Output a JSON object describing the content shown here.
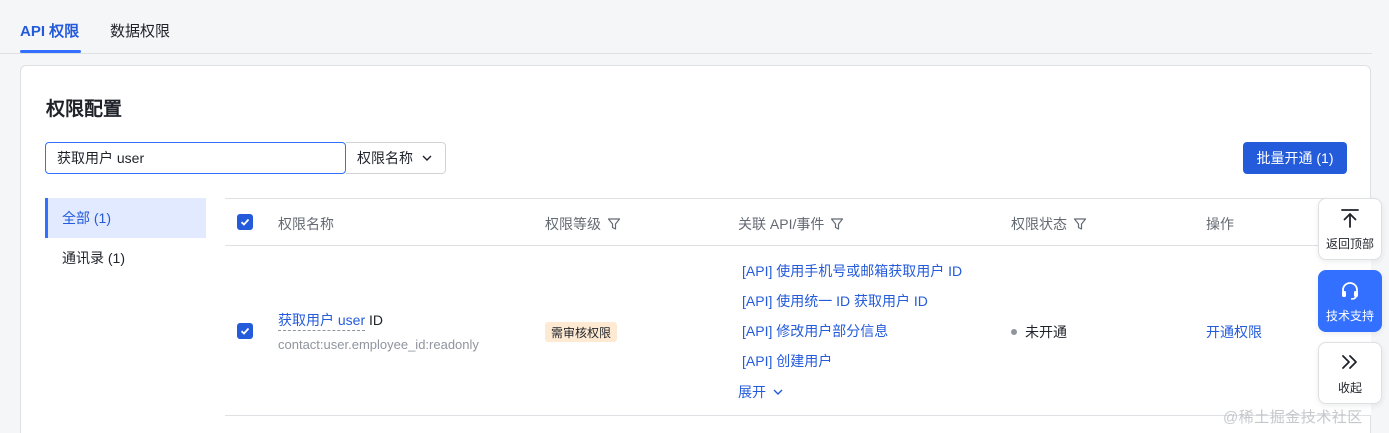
{
  "tabs": [
    {
      "label": "API 权限",
      "active": true
    },
    {
      "label": "数据权限",
      "active": false
    }
  ],
  "card": {
    "title": "权限配置"
  },
  "search": {
    "value": "获取用户 user",
    "filter_label": "权限名称"
  },
  "batch_button": "批量开通 (1)",
  "sidebar": {
    "items": [
      {
        "label": "全部 (1)",
        "active": true
      },
      {
        "label": "通讯录 (1)",
        "active": false
      }
    ]
  },
  "table": {
    "headers": {
      "name": "权限名称",
      "level": "权限等级",
      "api": "关联 API/事件",
      "status": "权限状态",
      "action": "操作"
    },
    "rows": [
      {
        "checked": true,
        "name_highlight": "获取用户 user",
        "name_rest": " ID",
        "code": "contact:user.employee_id:readonly",
        "level": "需审核权限",
        "apis": [
          "[API] 使用手机号或邮箱获取用户 ID",
          "[API] 使用统一 ID 获取用户 ID",
          "[API] 修改用户部分信息",
          "[API] 创建用户"
        ],
        "expand": "展开",
        "status": "未开通",
        "action": "开通权限"
      }
    ]
  },
  "float_toolbar": {
    "back_top": "返回顶部",
    "support": "技术支持",
    "collapse": "收起"
  },
  "watermark": "@稀土掘金技术社区",
  "colors": {
    "primary": "#245bdb",
    "accent": "#3370ff",
    "badge_bg": "#feead2"
  }
}
